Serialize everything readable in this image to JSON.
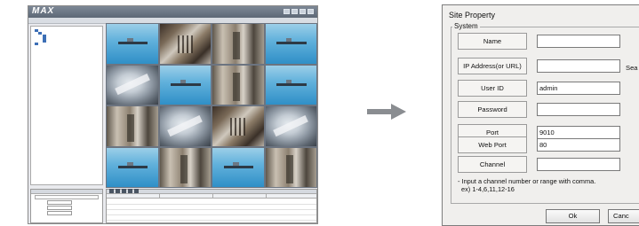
{
  "app": {
    "logo": "MAX",
    "tree": [
      "",
      "",
      "",
      "",
      "",
      ""
    ],
    "status": {
      "row1": "",
      "row2": "",
      "row3": ""
    },
    "cameras": [
      "sea",
      "gate",
      "street",
      "sea",
      "dish",
      "sea",
      "street",
      "sea",
      "street",
      "dish",
      "gate",
      "dish",
      "sea",
      "street",
      "sea",
      "street"
    ]
  },
  "arrow": {
    "color": "#8a8d91"
  },
  "dialog": {
    "title": "Site Property",
    "group_label": "System",
    "fields": [
      {
        "key": "name",
        "label": "Name",
        "value": ""
      },
      {
        "key": "ip",
        "label": "IP Address(or URL)",
        "value": ""
      },
      {
        "key": "user",
        "label": "User ID",
        "value": "admin"
      },
      {
        "key": "password",
        "label": "Password",
        "value": ""
      },
      {
        "key": "port",
        "label": "Port",
        "value": "9010"
      },
      {
        "key": "webport",
        "label": "Web Port",
        "value": "80"
      },
      {
        "key": "channel",
        "label": "Channel",
        "value": ""
      }
    ],
    "search_label": "Sea",
    "hint_line1": "- Input a channel number or range with comma.",
    "hint_line2": "ex) 1-4,6,11,12-16",
    "ok_label": "Ok",
    "cancel_label": "Canc"
  }
}
